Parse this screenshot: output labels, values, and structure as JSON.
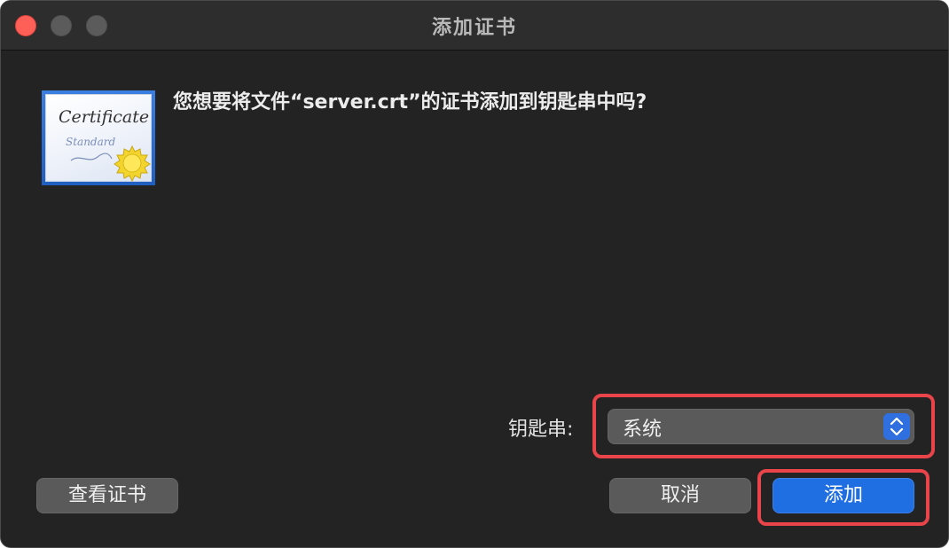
{
  "window": {
    "title": "添加证书"
  },
  "dialog": {
    "question": "您想要将文件“server.crt”的证书添加到钥匙串中吗?",
    "icon": {
      "name": "certificate-icon",
      "line1": "Certificate",
      "line2": "Standard"
    },
    "keychain": {
      "label": "钥匙串:",
      "selected": "系统"
    },
    "buttons": {
      "view_certificate": "查看证书",
      "cancel": "取消",
      "add": "添加"
    }
  },
  "colors": {
    "window_bg": "#232323",
    "titlebar_bg": "#2d2d2d",
    "close_button": "#fe5f57",
    "accent": "#1f6fe3",
    "highlight": "#e8444a"
  }
}
